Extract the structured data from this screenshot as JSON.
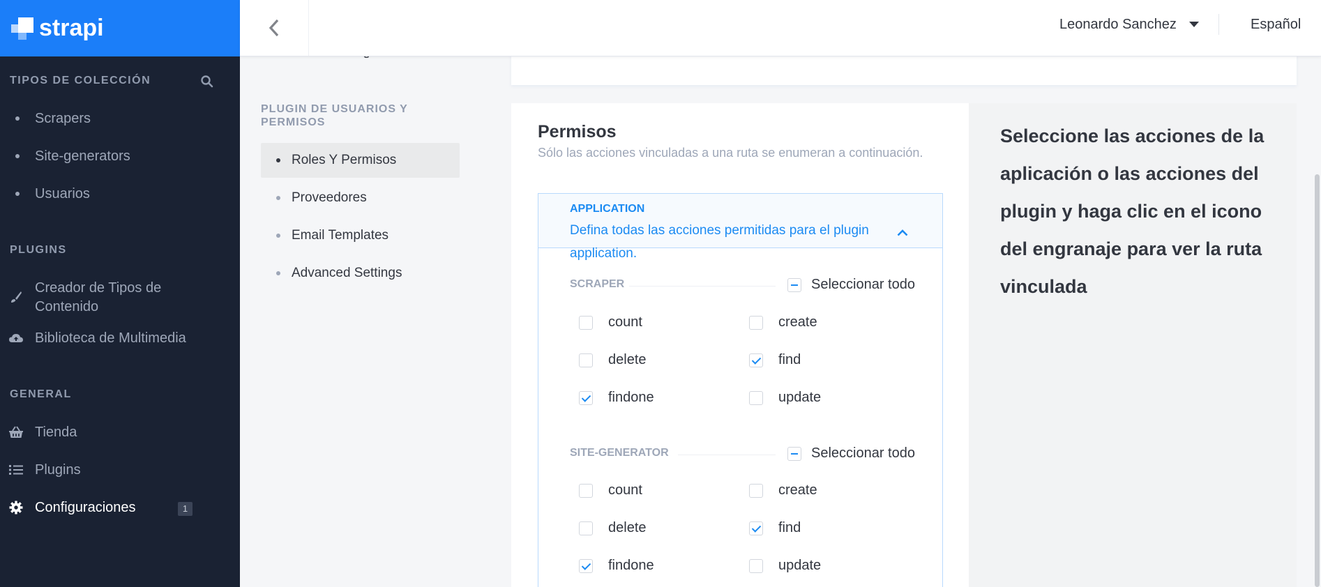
{
  "brand": {
    "name": "strapi"
  },
  "leftnav": {
    "collections_title": "TIPOS DE COLECCIÓN",
    "collections": [
      "Scrapers",
      "Site-generators",
      "Usuarios"
    ],
    "plugins_title": "PLUGINS",
    "plugins": [
      "Creador de Tipos de Contenido",
      "Biblioteca de Multimedia"
    ],
    "general_title": "GENERAL",
    "general": [
      "Tienda",
      "Plugins",
      "Configuraciones"
    ],
    "settings_badge": "1"
  },
  "header": {
    "user_name": "Leonardo Sanchez",
    "language": "Español"
  },
  "subnav": {
    "cut_item": "Email Settings",
    "section_title": "PLUGIN DE USUARIOS Y PERMISOS",
    "items": [
      "Roles Y Permisos",
      "Proveedores",
      "Email Templates",
      "Advanced Settings"
    ]
  },
  "permissions": {
    "title": "Permisos",
    "subtitle": "Sólo las acciones vinculadas a una ruta se enumeran a continuación.",
    "application": {
      "label": "APPLICATION",
      "description": "Defina todas las acciones permitidas para el plugin application."
    },
    "select_all_label": "Seleccionar todo",
    "groups": [
      {
        "name": "SCRAPER",
        "actions": [
          {
            "label": "count",
            "checked": false
          },
          {
            "label": "create",
            "checked": false
          },
          {
            "label": "delete",
            "checked": false
          },
          {
            "label": "find",
            "checked": true
          },
          {
            "label": "findone",
            "checked": true
          },
          {
            "label": "update",
            "checked": false
          }
        ]
      },
      {
        "name": "SITE-GENERATOR",
        "actions": [
          {
            "label": "count",
            "checked": false
          },
          {
            "label": "create",
            "checked": false
          },
          {
            "label": "delete",
            "checked": false
          },
          {
            "label": "find",
            "checked": true
          },
          {
            "label": "findone",
            "checked": true
          },
          {
            "label": "update",
            "checked": false
          }
        ]
      }
    ]
  },
  "info": {
    "text": "Seleccione las acciones de la aplicación o las acciones del plugin y haga clic en el icono del engranaje para ver la ruta vinculada"
  },
  "colors": {
    "brand": "#1b7ef9",
    "nav_bg": "#1a2233",
    "accent": "#1c8bf2"
  }
}
